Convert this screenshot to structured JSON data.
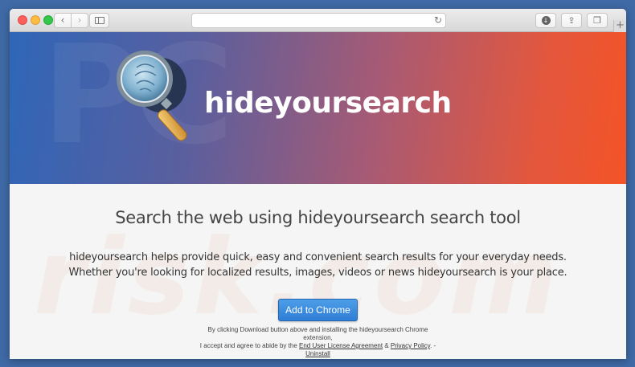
{
  "hero": {
    "brand": "hideyoursearch",
    "watermark": "PC"
  },
  "main": {
    "headline": "Search the web using hideyoursearch search tool",
    "desc_line1": "hideyoursearch helps provide quick, easy and convenient search results for your everyday needs.",
    "desc_line2": "Whether you're looking for localized results, images, videos or news hideyoursearch is your place.",
    "cta_label": "Add to Chrome",
    "watermark": "risk.com",
    "legal": {
      "line1": "By clicking Download button above and installing the hideyoursearch Chrome",
      "line2": "extension,",
      "line3_prefix": "I accept and agree to abide by the",
      "eula_link": "End User License Agreement",
      "amp": "&",
      "privacy_link": "Privacy Policy",
      "line3_suffix": ". -",
      "uninstall_link": "Uninstall"
    }
  },
  "browser": {
    "back_icon": "chevron-left-icon",
    "forward_icon": "chevron-right-icon",
    "reload_glyph": "↻",
    "plus_glyph": "+",
    "download_glyph": "↓",
    "share_glyph": "⇪",
    "tabs_glyph": "❐"
  },
  "colors": {
    "hero_start": "#2f66b8",
    "hero_end": "#f45426",
    "cta": "#3a8ae0"
  }
}
